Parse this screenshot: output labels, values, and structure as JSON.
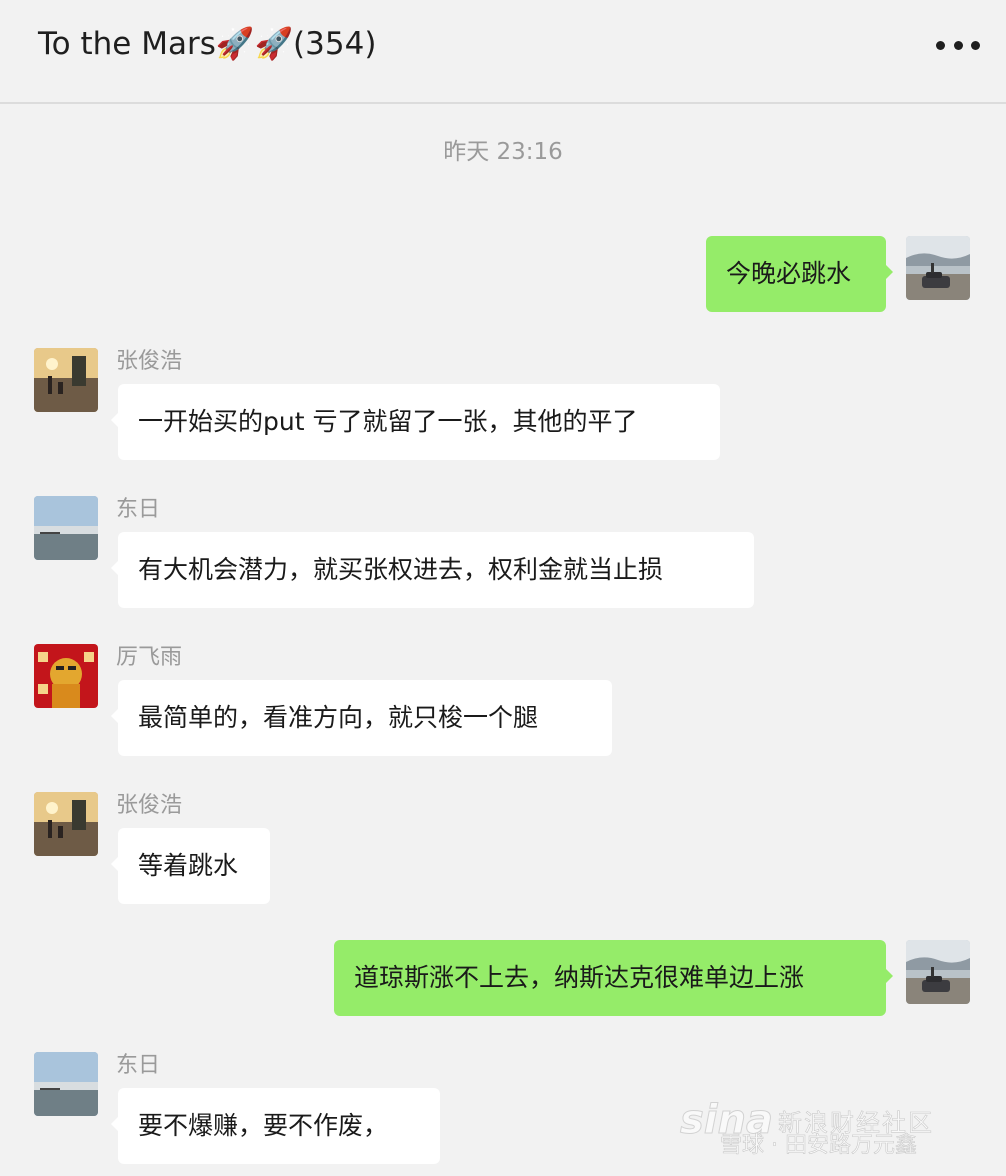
{
  "header": {
    "title": "To the Mars🚀🚀(354)",
    "more_icon": "more-dots-icon"
  },
  "timestamp": "昨天 23:16",
  "messages": [
    {
      "direction": "out",
      "text": "今晚必跳水",
      "avatar": "car-landscape-avatar"
    },
    {
      "direction": "in",
      "sender": "张俊浩",
      "text": "一开始买的put 亏了就留了一张，其他的平了",
      "avatar": "sunset-beach-avatar"
    },
    {
      "direction": "in",
      "sender": "东日",
      "text": "有大机会潜力，就买张权进去，权利金就当止损",
      "avatar": "seaside-sky-avatar"
    },
    {
      "direction": "in",
      "sender": "厉飞雨",
      "text": "最简单的，看准方向，就只梭一个腿",
      "avatar": "lucky-cat-avatar"
    },
    {
      "direction": "in",
      "sender": "张俊浩",
      "text": "等着跳水",
      "avatar": "sunset-beach-avatar"
    },
    {
      "direction": "out",
      "text": "道琼斯涨不上去，纳斯达克很难单边上涨",
      "avatar": "car-landscape-avatar"
    },
    {
      "direction": "in",
      "sender": "东日",
      "text": "要不爆赚，要不作废，",
      "avatar": "seaside-sky-avatar"
    }
  ],
  "watermark": {
    "logo": "sina",
    "line1": "新浪财经社区",
    "line2": "雪球 · 田安路万元鑫"
  },
  "colors": {
    "background": "#f2f2f2",
    "incoming_bubble": "#ffffff",
    "outgoing_bubble": "#95ec69"
  }
}
